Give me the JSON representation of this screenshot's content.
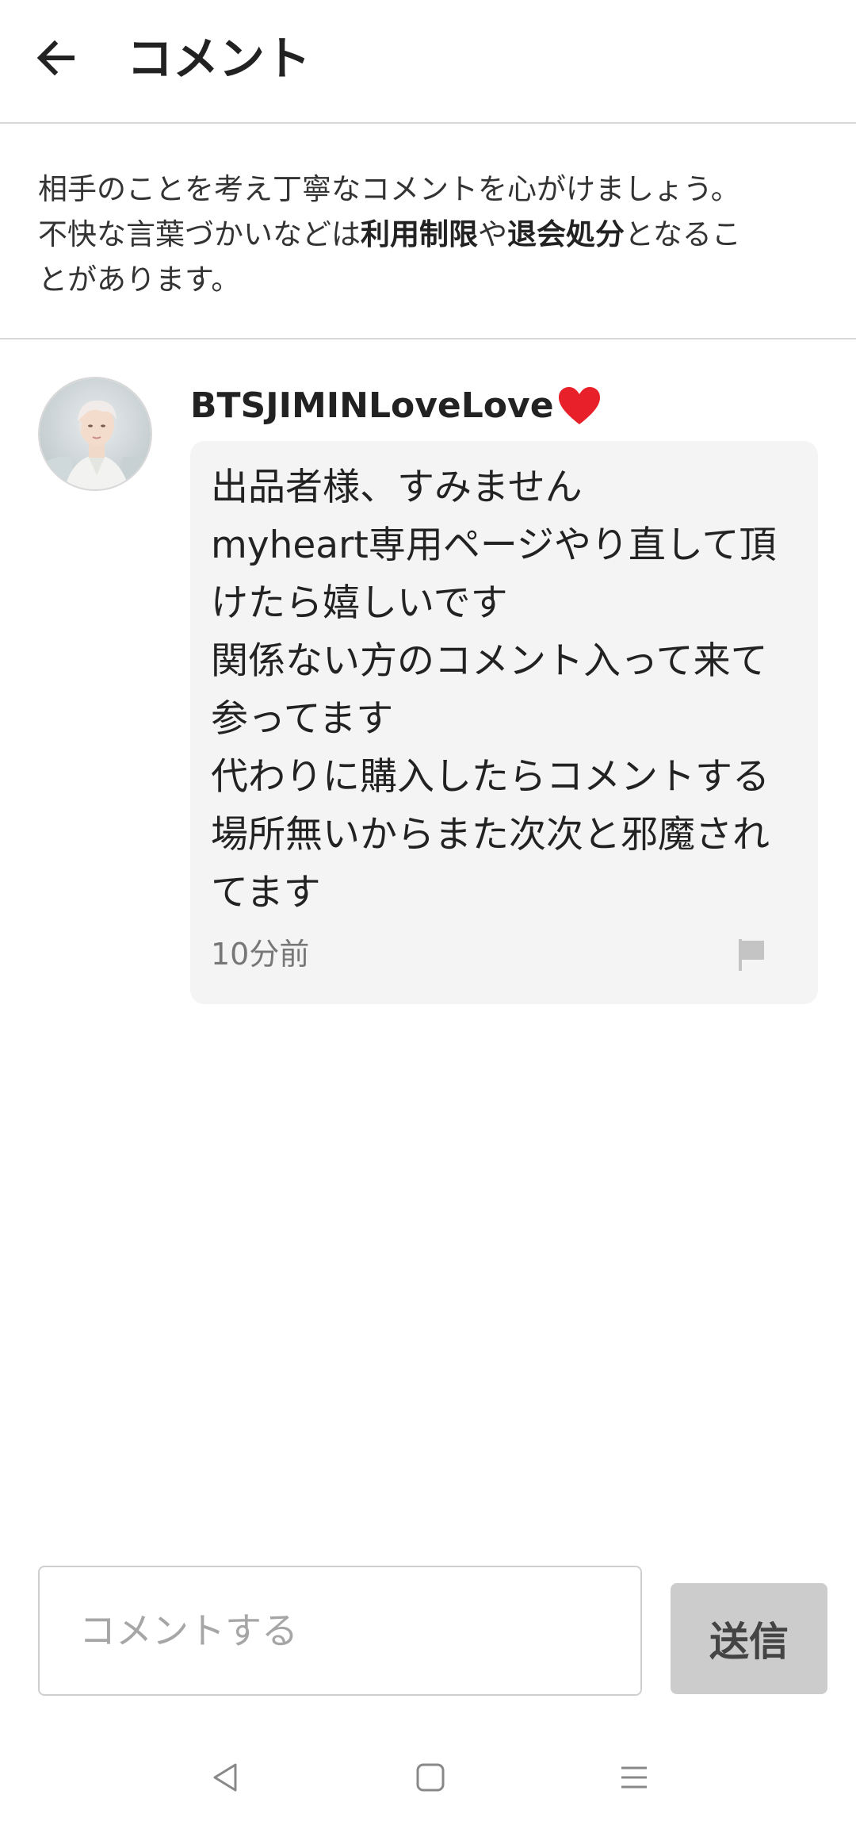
{
  "header": {
    "title": "コメント",
    "back_icon": "arrow-left-icon"
  },
  "notice": {
    "line1": "相手のことを考え丁寧なコメントを心がけましょう。",
    "line2_pre": "不快な言葉づかいなどは",
    "line2_bold1": "利用制限",
    "line2_mid": "や",
    "line2_bold2": "退会処分",
    "line2_post": "となるこ",
    "line3": "とがあります。"
  },
  "comment": {
    "username": "BTSJIMINLoveLove",
    "username_emoji_icon": "red-heart-icon",
    "avatar_icon": "user-avatar-photo",
    "body": "出品者様、すみません\nmyheart専用ページやり直して頂けたら嬉しいです\n関係ない方のコメント入って来て参ってます\n代わりに購入したらコメントする場所無いからまた次次と邪魔されてます",
    "time": "10分前",
    "flag_icon": "flag-icon"
  },
  "composer": {
    "placeholder": "コメントする",
    "value": "",
    "send_label": "送信"
  },
  "navbar": {
    "back_icon": "triangle-back-icon",
    "home_icon": "square-home-icon",
    "menu_icon": "hamburger-menu-icon"
  },
  "colors": {
    "heart": "#e8202a",
    "send_button_bg": "#cccccc",
    "divider": "#d9d9d9",
    "bubble_bg": "#f4f4f4"
  }
}
